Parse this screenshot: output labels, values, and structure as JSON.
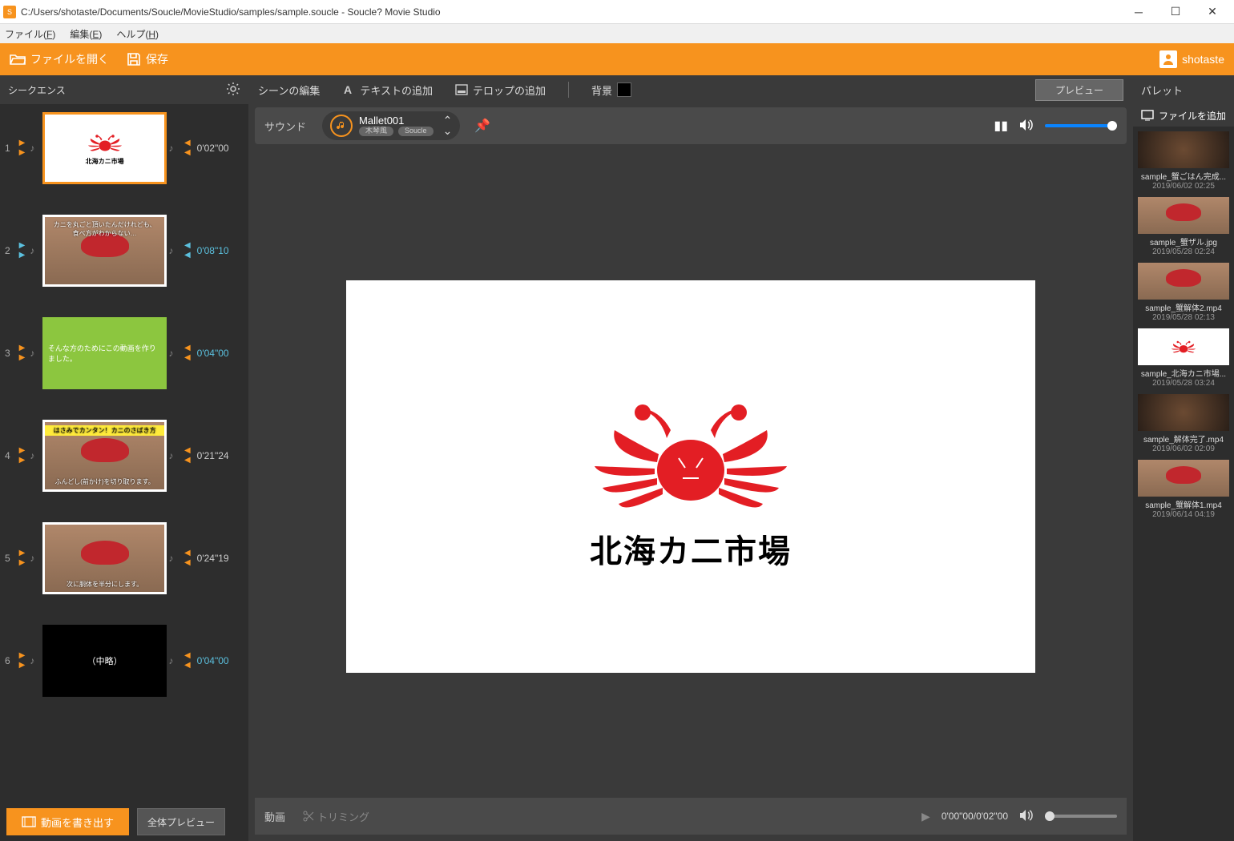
{
  "title": "C:/Users/shotaste/Documents/Soucle/MovieStudio/samples/sample.soucle - Soucle? Movie Studio",
  "menu": {
    "file": "ファイル(F)",
    "edit": "編集(E)",
    "help": "ヘルプ(H)"
  },
  "toolbar": {
    "open": "ファイルを開く",
    "save": "保存",
    "user": "shotaste"
  },
  "seq": {
    "title": "シークエンス",
    "export": "動画を書き出す",
    "preview_all": "全体プレビュー",
    "crab_title": "北海カニ市場",
    "items": [
      {
        "n": "1",
        "time": "0'02\"00",
        "sel": true,
        "type": "logo"
      },
      {
        "n": "2",
        "time": "0'08\"10",
        "sel": false,
        "type": "crab1",
        "cap1": "カニを丸ごと頂いたんだけれども、",
        "cap2": "食べ方がわからない…"
      },
      {
        "n": "3",
        "time": "0'04\"00",
        "sel": false,
        "type": "green",
        "cap": "そんな方のためにこの動画を作りました。"
      },
      {
        "n": "4",
        "time": "0'21\"24",
        "sel": false,
        "type": "crab2",
        "capTop": "はさみでカンタン！カニのさばき方",
        "capBot": "ふんどし(前かけ)を切り取ります。"
      },
      {
        "n": "5",
        "time": "0'24\"19",
        "sel": false,
        "type": "crab3",
        "capBot": "次に胴体を半分にします。"
      },
      {
        "n": "6",
        "time": "0'04\"00",
        "sel": false,
        "type": "black",
        "cap": "（中略）"
      }
    ]
  },
  "editor": {
    "scene_edit": "シーンの編集",
    "add_text": "テキストの追加",
    "add_telop": "テロップの追加",
    "bg": "背景",
    "preview": "プレビュー",
    "sound_label": "サウンド",
    "sound_name": "Mallet001",
    "sound_tag1": "木琴風",
    "sound_tag2": "Soucle",
    "video_label": "動画",
    "trim": "トリミング",
    "vtime": "0'00\"00/0'02\"00"
  },
  "canvas": {
    "crab_title": "北海カ二市場"
  },
  "palette": {
    "title": "パレット",
    "add": "ファイルを追加",
    "items": [
      {
        "name": "sample_蟹ごはん完成...",
        "date": "2019/06/02 02:25",
        "type": "dark"
      },
      {
        "name": "sample_蟹ザル.jpg",
        "date": "2019/05/28 02:24",
        "type": "crab"
      },
      {
        "name": "sample_蟹解体2.mp4",
        "date": "2019/05/28 02:13",
        "type": "crab"
      },
      {
        "name": "sample_北海カニ市場...",
        "date": "2019/05/28 03:24",
        "type": "logo"
      },
      {
        "name": "sample_解体完了.mp4",
        "date": "2019/06/02 02:09",
        "type": "dark"
      },
      {
        "name": "sample_蟹解体1.mp4",
        "date": "2019/06/14 04:19",
        "type": "crab"
      }
    ]
  }
}
